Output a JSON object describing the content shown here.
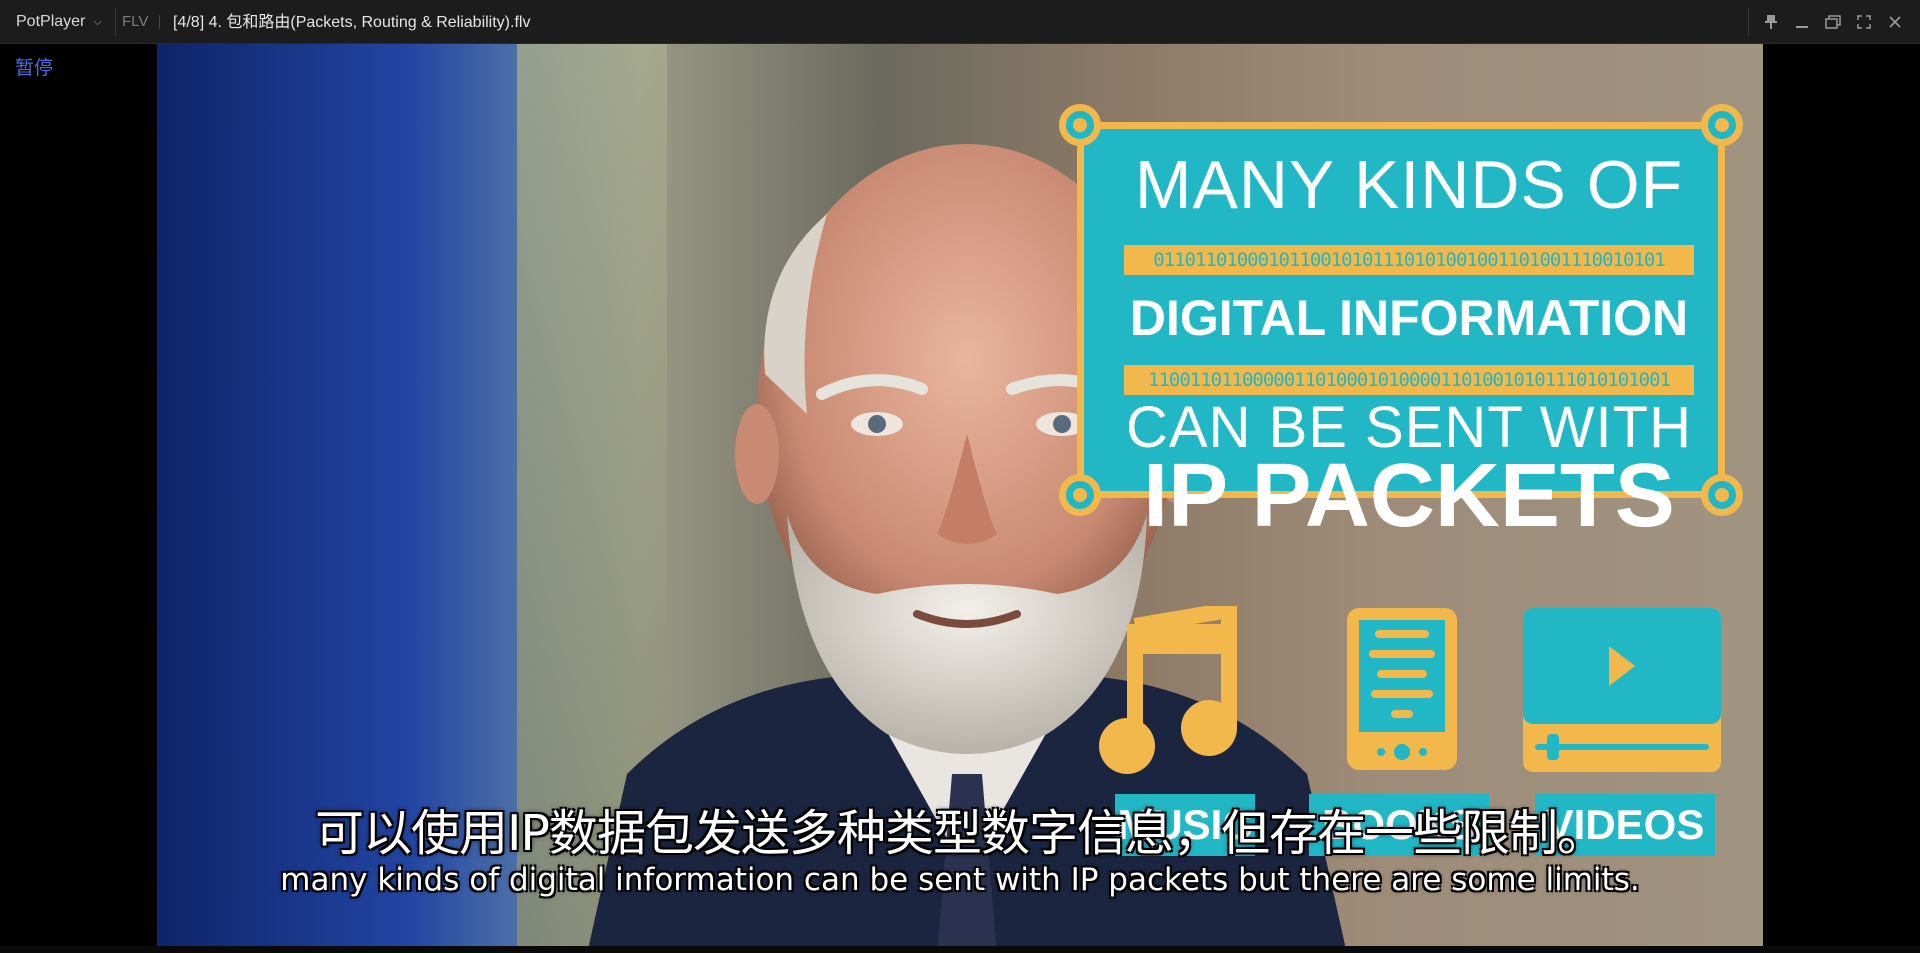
{
  "app": {
    "name": "PotPlayer",
    "format": "FLV",
    "file_title": "[4/8] 4. 包和路由(Packets, Routing & Reliability).flv"
  },
  "window_buttons": [
    "pin-icon",
    "minimize-icon",
    "restore-icon",
    "fullscreen-icon",
    "close-icon"
  ],
  "status_text": "暂停",
  "video": {
    "card": {
      "line1": "MANY KINDS OF",
      "binary1": "0110110100010110010101110101001001101001110010101",
      "line2": "DIGITAL INFORMATION",
      "binary2": "11001101100000110100010100001101001010111010101001",
      "line3": "CAN BE SENT WITH",
      "line4": "IP PACKETS"
    },
    "media_labels": {
      "music": "MUSIC",
      "books": "BOOKS",
      "videos": "VIDEOS"
    },
    "colors": {
      "teal": "#21b7c5",
      "gold": "#f2b84b"
    }
  },
  "subtitles": {
    "zh": "可以使用IP数据包发送多种类型数字信息，但存在一些限制。",
    "en": "many kinds of digital information can be sent with IP packets but there are some limits."
  }
}
